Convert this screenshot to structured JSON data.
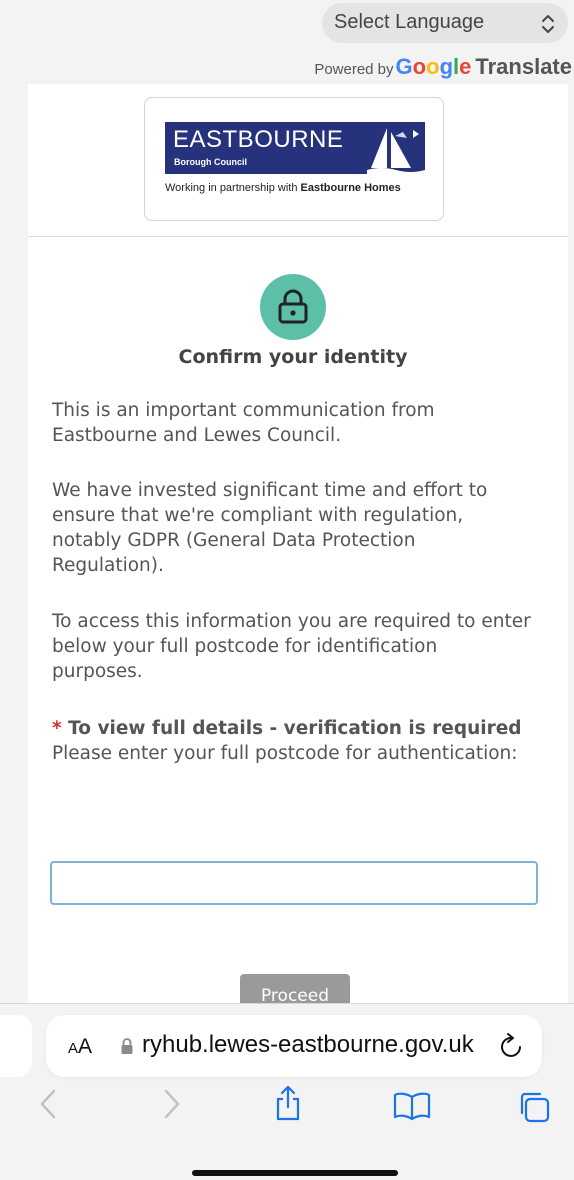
{
  "header": {
    "language_select": {
      "label": "Select Language",
      "icon": "up-down-chevron-icon"
    },
    "powered_by": {
      "prefix": "Powered by",
      "google_letters": [
        {
          "char": "G",
          "color": "#4285F4"
        },
        {
          "char": "o",
          "color": "#EA4335"
        },
        {
          "char": "o",
          "color": "#FBBC05"
        },
        {
          "char": "g",
          "color": "#4285F4"
        },
        {
          "char": "l",
          "color": "#34A853"
        },
        {
          "char": "e",
          "color": "#EA4335"
        }
      ],
      "suffix": "Translate"
    }
  },
  "logo": {
    "name": "EASTBOURNE",
    "subtitle": "Borough Council",
    "tagline_prefix": "Working in partnership with",
    "tagline_bold": "Eastbourne Homes",
    "banner_color": "#26337c"
  },
  "main": {
    "icon": "padlock-icon",
    "accent_color": "#5cc0a9",
    "title": "Confirm your identity",
    "paragraphs": [
      "This is an important communication from Eastbourne and Lewes Council.",
      "We have invested significant time and effort to ensure that we're compliant with regulation, notably GDPR (General Data Protection Regulation).",
      "To access this information you are required to enter below your full postcode for identification purposes."
    ],
    "required": {
      "star": "*",
      "heading": "To view full details - verification is required",
      "text": "Please enter your full postcode for authentication:"
    },
    "postcode_value": "",
    "proceed_label": "Proceed"
  },
  "browser": {
    "aa_small": "A",
    "aa_large": "A",
    "url": "ryhub.lewes-eastbourne.gov.uk",
    "toolbar_icons": [
      "back-icon",
      "forward-icon",
      "share-icon",
      "bookmarks-icon",
      "tabs-icon"
    ]
  }
}
